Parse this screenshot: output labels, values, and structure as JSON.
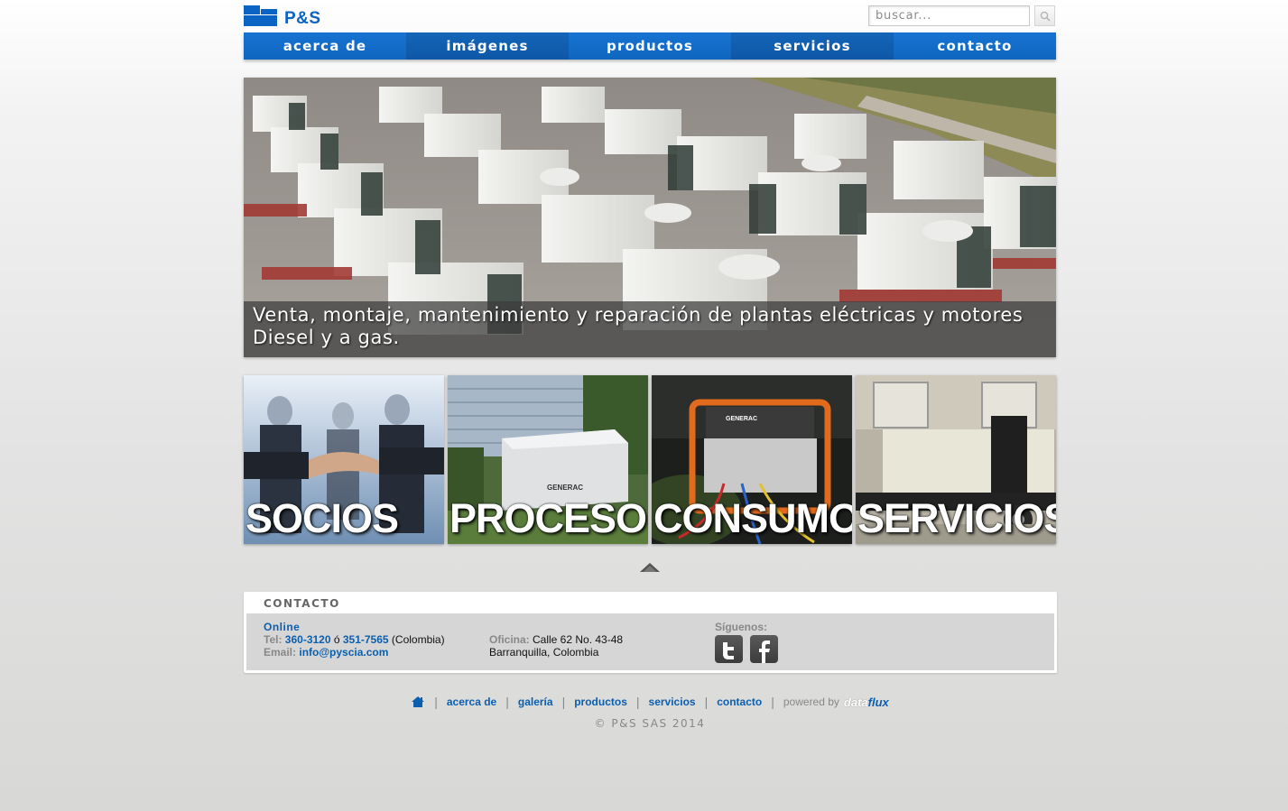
{
  "brand": {
    "name": "P&S"
  },
  "search": {
    "placeholder": "buscar..."
  },
  "nav": [
    {
      "label": "acerca de"
    },
    {
      "label": "imágenes"
    },
    {
      "label": "productos"
    },
    {
      "label": "servicios"
    },
    {
      "label": "contacto"
    }
  ],
  "hero": {
    "caption": "Venta, montaje, mantenimiento y reparación de plantas eléctricas y motores Diesel y a gas."
  },
  "tiles": [
    {
      "label": "SOCIOS"
    },
    {
      "label": "PROCESO"
    },
    {
      "label": "CONSUMO"
    },
    {
      "label": "SERVICIOS"
    }
  ],
  "contact": {
    "title": "CONTACTO",
    "online": "Online",
    "tel_label": "Tel:",
    "tel1": "360-3120",
    "tel_or": " ó ",
    "tel2": "351-7565",
    "tel_country": " (Colombia)",
    "email_label": "Email:",
    "email": "info@pyscia.com",
    "office_label": "Oficina:",
    "office_line1": " Calle 62 No. 43-48",
    "office_line2": "Barranquilla, Colombia",
    "follow_label": "Síguenos:",
    "social": [
      "twitter-icon",
      "facebook-icon"
    ]
  },
  "footer": {
    "links": [
      "acerca de",
      "galería",
      "productos",
      "servicios",
      "contacto"
    ],
    "powered_by": "powered by",
    "brand_a": "data",
    "brand_b": "flux",
    "copyright": "© P&S SAS 2014"
  },
  "colors": {
    "accent": "#0f66c0",
    "accent_dark": "#0e57a6",
    "link": "#0b5fae"
  }
}
